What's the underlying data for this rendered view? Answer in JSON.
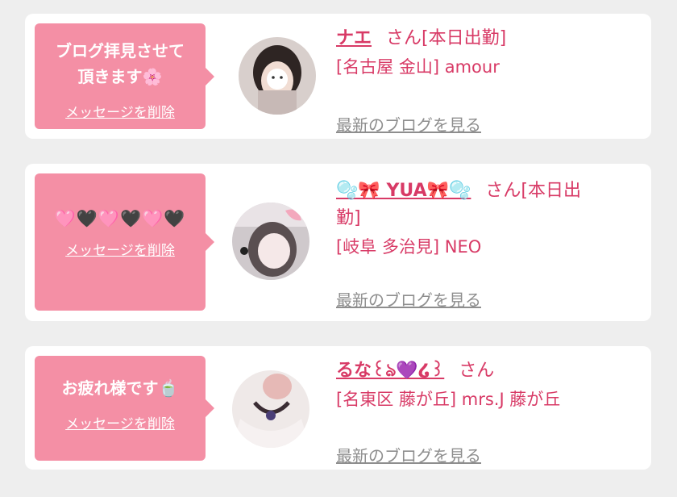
{
  "messages": [
    {
      "bubble_text_1": "ブログ拝見させて",
      "bubble_text_2": "頂きます🌸",
      "delete_label": "メッセージを削除",
      "name": "ナエ",
      "honorific": "さん[本日出勤]",
      "shop": "[名古屋 金山] amour",
      "blog_link": "最新のブログを見る",
      "avatar_icon": "avatar-photo",
      "avatar_colors": [
        "#cfc6c3",
        "#8f7f7a"
      ]
    },
    {
      "bubble_text_1": "🩷🖤🩷🖤🩷🖤",
      "delete_label": "メッセージを削除",
      "name": "🫧🎀 YUA🎀🫧",
      "honorific": "さん[本日出",
      "honorific_2": "勤]",
      "shop": "[岐阜 多治見] NEO",
      "blog_link": "最新のブログを見る",
      "avatar_icon": "avatar-photo",
      "avatar_colors": [
        "#d9d2d6",
        "#6f6f74"
      ]
    },
    {
      "bubble_text_1": "お疲れ様です🍵",
      "delete_label": "メッセージを削除",
      "name": "るな꒰ঌ💜໒꒱",
      "honorific": "さん",
      "shop": "[名東区 藤が丘] mrs.J 藤が丘",
      "blog_link": "最新のブログを見る",
      "avatar_icon": "avatar-photo",
      "avatar_colors": [
        "#e7e1df",
        "#5e4f52"
      ]
    }
  ],
  "colors": {
    "page_bg": "#eeeeee",
    "card_bg": "#ffffff",
    "bubble_bg": "#f48fa5",
    "accent_text": "#d83a66",
    "link_gray": "#8e8e8e"
  }
}
